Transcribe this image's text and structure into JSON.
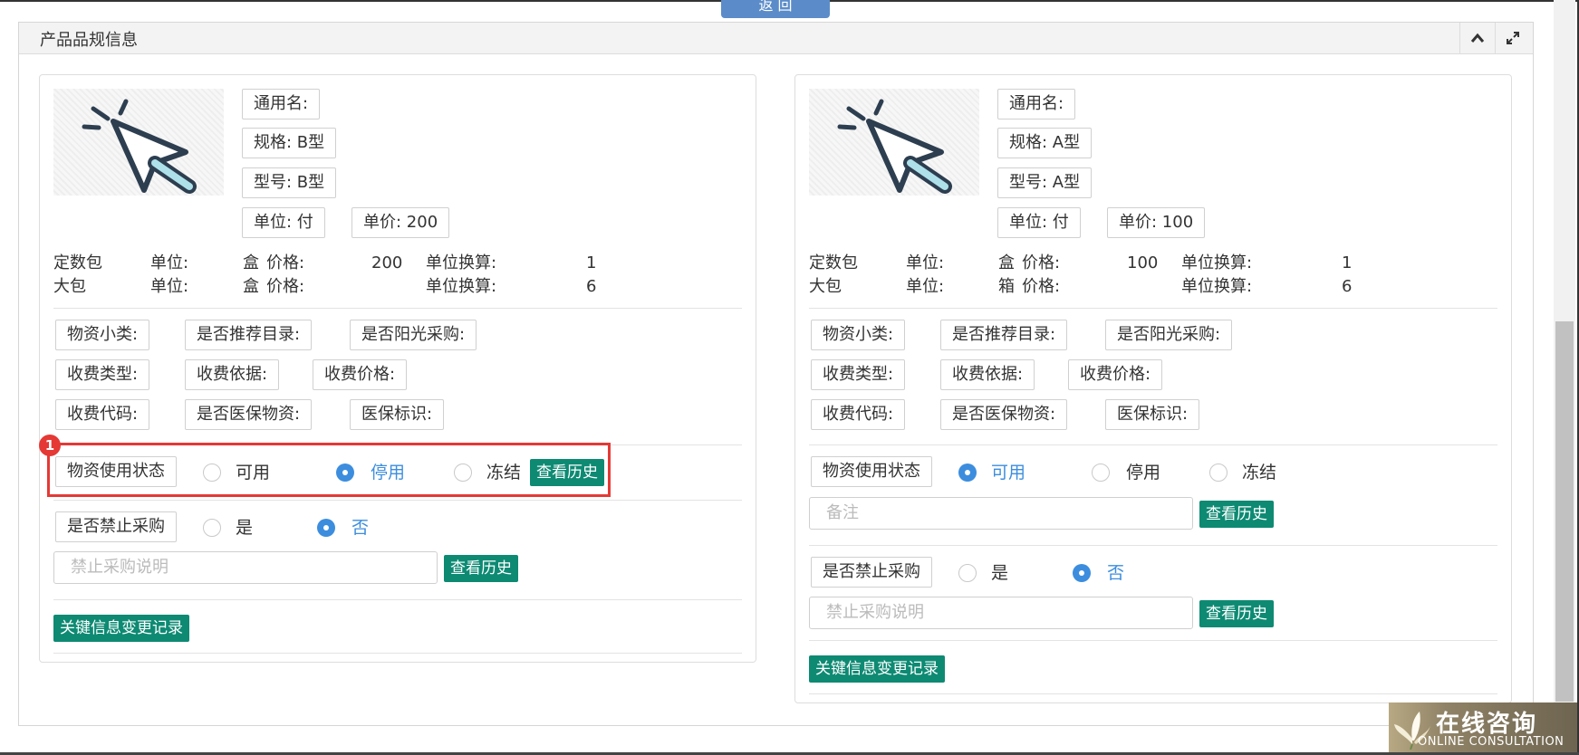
{
  "top_tab": {
    "label": "返 回"
  },
  "panel": {
    "title": "产品品规信息",
    "collapse_icon": "chevron-up-icon",
    "expand_icon": "expand-icon"
  },
  "left_card": {
    "image_icon": "cursor-icon",
    "common_name": "通用名:",
    "spec": "规格: B型",
    "model": "型号: B型",
    "unit": "单位: 付",
    "unit_price": "单价: 200",
    "packages": [
      {
        "name": "定数包",
        "unit_label": "单位:",
        "unit": "盒",
        "price_label": "价格:",
        "price": "200",
        "conv_label": "单位换算:",
        "conv": "1"
      },
      {
        "name": "大包",
        "unit_label": "单位:",
        "unit": "盒",
        "price_label": "价格:",
        "price": "",
        "conv_label": "单位换算:",
        "conv": "6"
      }
    ],
    "fields": {
      "category": "物资小类:",
      "recommended": "是否推荐目录:",
      "sunshine": "是否阳光采购:",
      "charge_type": "收费类型:",
      "charge_basis": "收费依据:",
      "charge_price": "收费价格:",
      "charge_code": "收费代码:",
      "insured": "是否医保物资:",
      "insurance_mark": "医保标识:"
    },
    "status": {
      "label": "物资使用状态",
      "options": [
        "可用",
        "停用",
        "冻结"
      ],
      "selected": "停用",
      "history_button": "查看历史"
    },
    "ban": {
      "label": "是否禁止采购",
      "options": [
        "是",
        "否"
      ],
      "selected": "否",
      "placeholder": "禁止采购说明",
      "history_button": "查看历史"
    },
    "change_log_button": "关键信息变更记录",
    "annotation_badge": "1"
  },
  "right_card": {
    "image_icon": "cursor-icon",
    "common_name": "通用名:",
    "spec": "规格: A型",
    "model": "型号: A型",
    "unit": "单位: 付",
    "unit_price": "单价: 100",
    "packages": [
      {
        "name": "定数包",
        "unit_label": "单位:",
        "unit": "盒",
        "price_label": "价格:",
        "price": "100",
        "conv_label": "单位换算:",
        "conv": "1"
      },
      {
        "name": "大包",
        "unit_label": "单位:",
        "unit": "箱",
        "price_label": "价格:",
        "price": "",
        "conv_label": "单位换算:",
        "conv": "6"
      }
    ],
    "fields": {
      "category": "物资小类:",
      "recommended": "是否推荐目录:",
      "sunshine": "是否阳光采购:",
      "charge_type": "收费类型:",
      "charge_basis": "收费依据:",
      "charge_price": "收费价格:",
      "charge_code": "收费代码:",
      "insured": "是否医保物资:",
      "insurance_mark": "医保标识:"
    },
    "status": {
      "label": "物资使用状态",
      "options": [
        "可用",
        "停用",
        "冻结"
      ],
      "selected": "可用",
      "remark_placeholder": "备注",
      "history_button": "查看历史"
    },
    "ban": {
      "label": "是否禁止采购",
      "options": [
        "是",
        "否"
      ],
      "selected": "否",
      "placeholder": "禁止采购说明",
      "history_button": "查看历史"
    },
    "change_log_button": "关键信息变更记录"
  },
  "consult_widget": {
    "title": "在线咨询",
    "subtitle": "ONLINE CONSULTATION"
  }
}
